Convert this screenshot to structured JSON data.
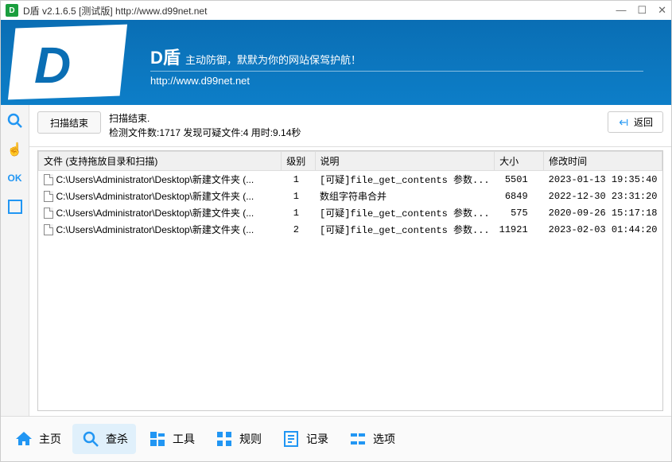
{
  "titlebar": {
    "icon_letter": "D",
    "title": "D盾 v2.1.6.5 [测试版] http://www.d99net.net"
  },
  "banner": {
    "logo_letter": "D",
    "brand": "D盾",
    "slogan": "主动防御，默默为你的网站保驾护航！",
    "url": "http://www.d99net.net"
  },
  "sidebar": {
    "search": "🔍",
    "hand": "👆",
    "ok": "OK",
    "box": "▢"
  },
  "status": {
    "scan_btn": "扫描结束",
    "line1": "扫描结束.",
    "line2": "检测文件数:1717 发现可疑文件:4 用时:9.14秒",
    "back": "返回"
  },
  "table": {
    "headers": {
      "file": "文件 (支持拖放目录和扫描)",
      "level": "级别",
      "desc": "说明",
      "size": "大小",
      "mtime": "修改时间"
    },
    "rows": [
      {
        "file": "C:\\Users\\Administrator\\Desktop\\新建文件夹 (...",
        "level": "1",
        "desc": "[可疑]file_get_contents 参数...",
        "size": "5501",
        "mtime": "2023-01-13 19:35:40"
      },
      {
        "file": "C:\\Users\\Administrator\\Desktop\\新建文件夹 (...",
        "level": "1",
        "desc": "数组字符串合并",
        "size": "6849",
        "mtime": "2022-12-30 23:31:20"
      },
      {
        "file": "C:\\Users\\Administrator\\Desktop\\新建文件夹 (...",
        "level": "1",
        "desc": "[可疑]file_get_contents 参数...",
        "size": "575",
        "mtime": "2020-09-26 15:17:18"
      },
      {
        "file": "C:\\Users\\Administrator\\Desktop\\新建文件夹 (...",
        "level": "2",
        "desc": "[可疑]file_get_contents 参数...",
        "size": "11921",
        "mtime": "2023-02-03 01:44:20"
      }
    ]
  },
  "nav": {
    "home": "主页",
    "scan": "查杀",
    "tools": "工具",
    "rules": "规则",
    "log": "记录",
    "options": "选项"
  }
}
